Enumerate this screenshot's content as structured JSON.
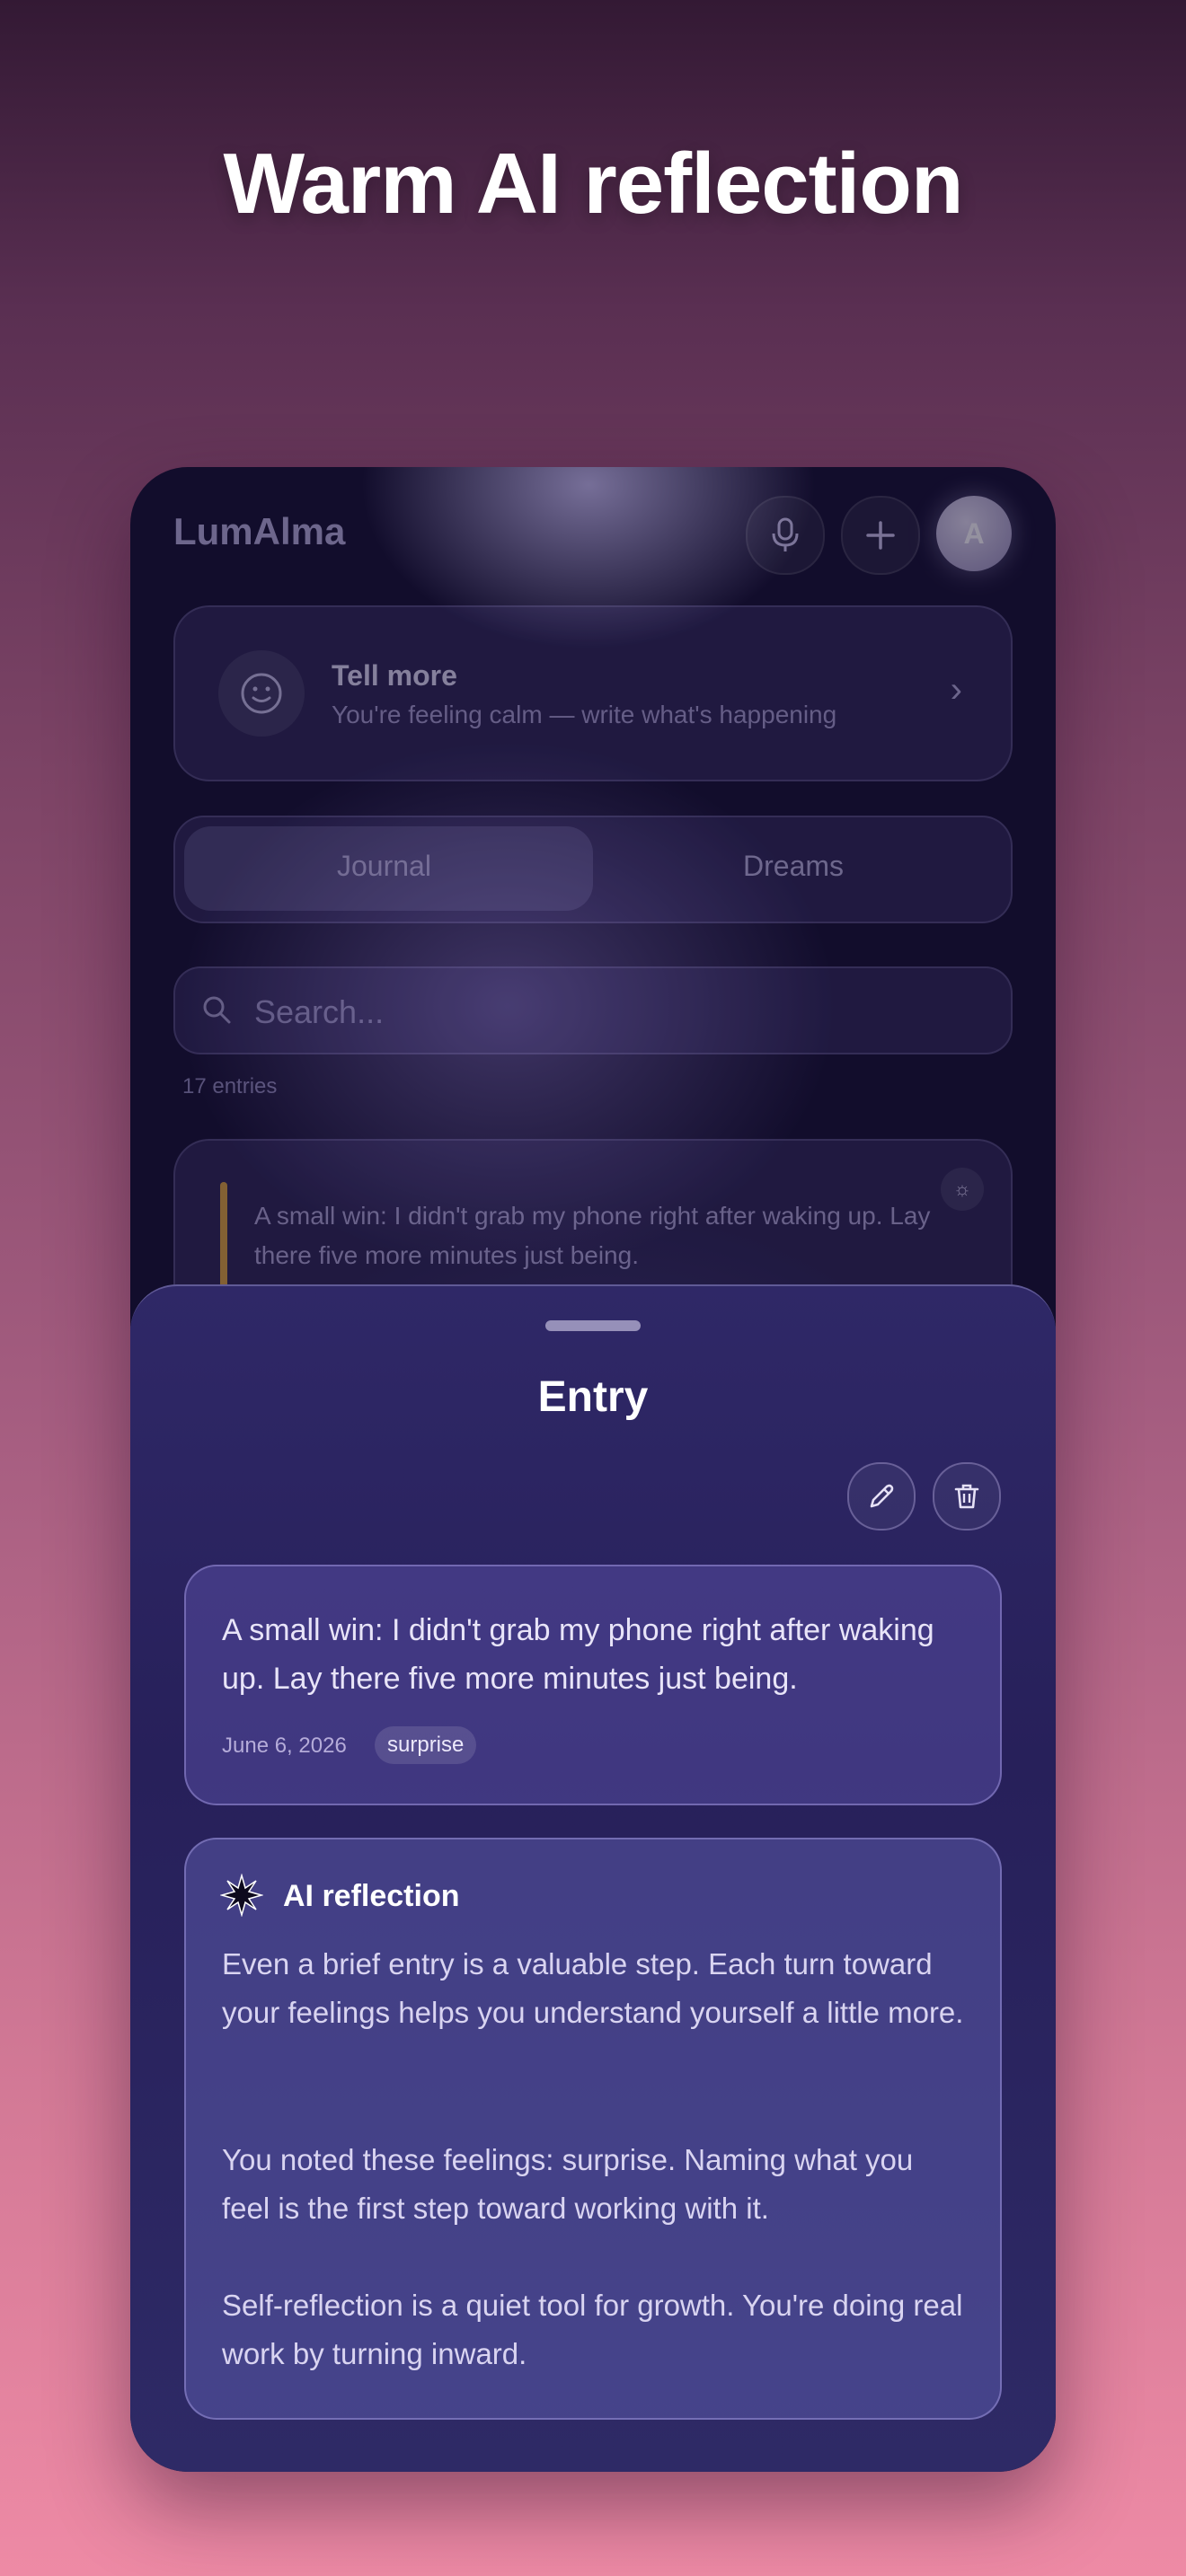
{
  "headline": "Warm AI reflection",
  "app": {
    "brand": "LumAlma",
    "avatar_letter": "A",
    "prompt_card": {
      "title": "Tell more",
      "subtitle": "You're feeling calm — write what's happening"
    },
    "segments": [
      "Journal",
      "Dreams"
    ],
    "search_placeholder": "Search...",
    "entries_count": "17 entries",
    "bg_entry_text": "A small win: I didn't grab my phone right after waking up. Lay there five more minutes just being."
  },
  "sheet": {
    "title": "Entry",
    "entry": {
      "text": "A small win: I didn't grab my phone right after waking up. Lay there five more minutes just being.",
      "date": "June 6, 2026",
      "tag": "surprise"
    },
    "reflection": {
      "title": "AI reflection",
      "paragraphs": [
        "Even a brief entry is a valuable step. Each turn toward your feelings helps you understand yourself a little more.",
        "You noted these feelings: surprise. Naming what you feel is the first step toward working with it.",
        "Self-reflection is a quiet tool for growth. You're doing real work by turning inward."
      ]
    }
  },
  "colors": {
    "accent_bar": "#e0a53a",
    "sheet_bg": "#2f2867",
    "panel_bg": "#5f55af"
  }
}
